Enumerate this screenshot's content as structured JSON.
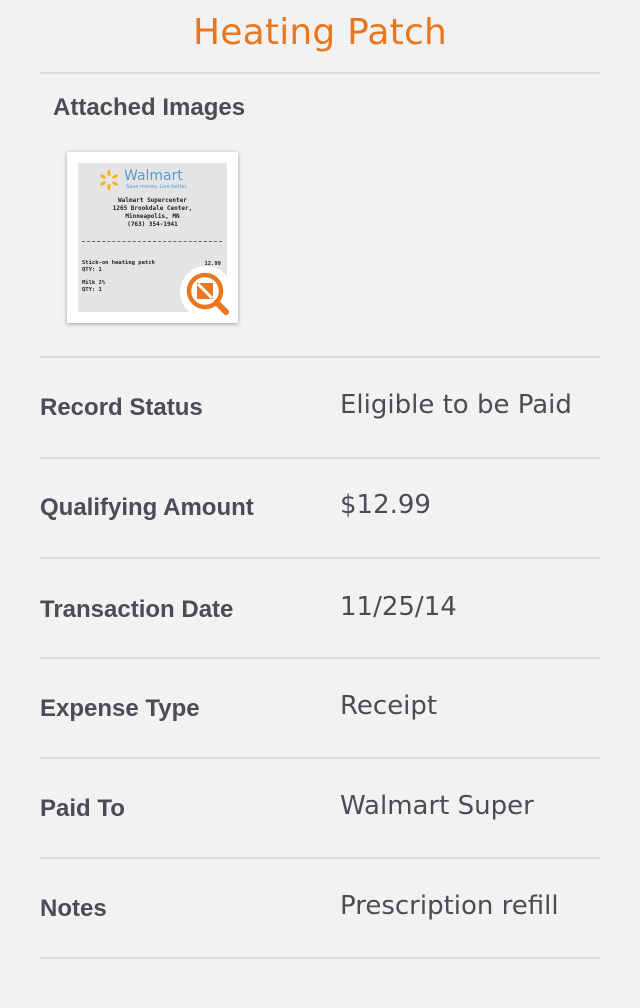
{
  "header": {
    "title": "Heating Patch"
  },
  "attachments": {
    "section_label": "Attached Images",
    "receipt": {
      "brand": "Walmart",
      "tagline": "Save money. Live better.",
      "store_name": "Walmart Supercenter",
      "address_line1": "1265 Brookdale Center,",
      "address_line2": "Minneapolis, MN",
      "phone": "(763) 354-1941",
      "item1": "Stick-on heating patch",
      "item1_qty": "QTY: 1",
      "item1_price": "12.99",
      "item2": "Milk 2%",
      "item2_qty": "QTY: 1"
    },
    "zoom_icon": "magnify-zoom-icon",
    "accent_color": "#e8771f"
  },
  "details": [
    {
      "label": "Record Status",
      "value": "Eligible to be Paid"
    },
    {
      "label": "Qualifying Amount",
      "value": "$12.99"
    },
    {
      "label": "Transaction Date",
      "value": "11/25/14"
    },
    {
      "label": "Expense Type",
      "value": "Receipt"
    },
    {
      "label": "Paid To",
      "value": "Walmart Super"
    },
    {
      "label": "Notes",
      "value": "Prescription refill"
    }
  ]
}
